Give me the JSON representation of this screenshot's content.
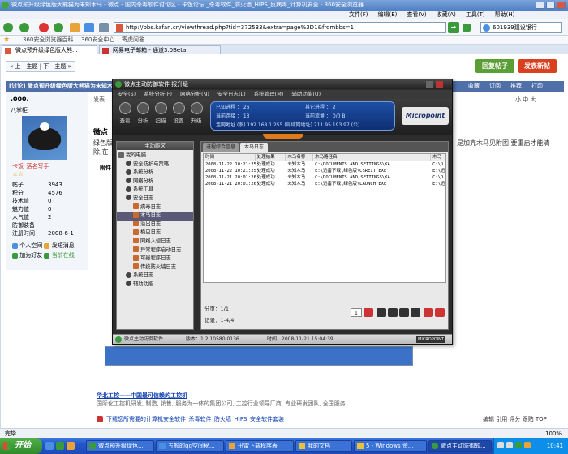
{
  "browser": {
    "window_title": "微点预升级绿色版大熊猫为未知木马 - 微点 - 国内杀毒软件讨论区 - 卡饭论坛 _杀毒软件_防火墙_HIPS_反病毒_计算机安全 - 360安全浏览器",
    "menu": [
      "文件(F)",
      "编辑(E)",
      "查看(V)",
      "收藏(A)",
      "工具(T)",
      "帮助(H)"
    ],
    "address": "http://bbs.kafan.cn/viewthread.php?tid=372533&extra=page%3D1&frombbs=1",
    "go_label": "➜",
    "search_value": "601939建设银行",
    "favorites": [
      "360安全浏览器百科",
      "360安全中心",
      "寄虎问答"
    ],
    "tabs": [
      "微点预升级绿色版大熊...",
      "网易电子邮箱 - 通道3.0Beta"
    ]
  },
  "forum": {
    "nav": "« 上一主题 | 下一主题 »",
    "reply_label": "回复帖子",
    "newpost_label": "发表新帖",
    "thread_bar": "[讨论] 微点预升级绿色版大熊猫为未知木马",
    "thread_tools": [
      "收藏",
      "订阅",
      "推荐",
      "打印"
    ],
    "user": {
      "name": ".ooo.",
      "floor_label": "发表",
      "title": "八掌柜",
      "honor": "卡饭_落名写手",
      "stars": "☆☆",
      "stats": [
        {
          "k": "帖子",
          "v": "3943"
        },
        {
          "k": "积分",
          "v": "4576"
        },
        {
          "k": "技术值",
          "v": "0"
        },
        {
          "k": "魅力值",
          "v": "0"
        },
        {
          "k": "人气值",
          "v": "2"
        },
        {
          "k": "防御装备",
          "v": ""
        },
        {
          "k": "注册时间",
          "v": "2008-6-1"
        }
      ],
      "links": [
        "个人空间",
        "发短消息",
        "加为好友",
        "当前在线"
      ]
    },
    "font_sizes": "小 中 大",
    "post_fragment_left": "微点",
    "post_body_left": "绿色版",
    "post_body_left2": "除,在",
    "post_body_right": "是加壳木马见附图 要重启才能清",
    "attach_label": "附件",
    "ad_title": "华北工控——中国最可信赖的工控机",
    "ad_desc": "国际化工控机研发, 制造, 销售, 服务为一体的集团公司, 工控行业领导厂商, 专业研发团队, 全国服务",
    "bottom_link": "下载您所需要的计算机安全软件_杀毒软件_防火墙_HIPS_安全软件套装",
    "bottom_tools": "编辑 引用 评分 跟贴 TOP"
  },
  "dialog": {
    "title": "微点主动防御软件   报升级",
    "menu": [
      "安全(S)",
      "系统分析(F)",
      "网络分析(N)",
      "安全日志(L)",
      "系统管理(M)",
      "辅助功能(U)"
    ],
    "toolbar": [
      "查看",
      "分析",
      "扫描",
      "设置",
      "升级"
    ],
    "status_panel": {
      "r1": [
        {
          "k": "已知进程",
          "v": "26"
        },
        {
          "k": "其它进程",
          "v": "2"
        }
      ],
      "r2": [
        {
          "k": "当前连接",
          "v": "13"
        },
        {
          "k": "当前流量",
          "v": "0/0 B"
        }
      ],
      "r3": {
        "k": "连网地址",
        "v": "(系)  192.168.1.255 (局域网地址)     211.95.193.97 (公)"
      }
    },
    "logo": "Micropoint",
    "sidebar_header": "主功能区",
    "tree": [
      {
        "label": "我的电脑",
        "lvl": 0,
        "sel": false
      },
      {
        "label": "安全防护与策略",
        "lvl": 1,
        "sel": false
      },
      {
        "label": "系统分析",
        "lvl": 1,
        "sel": false
      },
      {
        "label": "网络分析",
        "lvl": 1,
        "sel": false
      },
      {
        "label": "系统工具",
        "lvl": 1,
        "sel": false
      },
      {
        "label": "安全日志",
        "lvl": 1,
        "sel": false
      },
      {
        "label": "病毒日志",
        "lvl": 2,
        "sel": false
      },
      {
        "label": "木马日志",
        "lvl": 2,
        "sel": true
      },
      {
        "label": "溢出日志",
        "lvl": 2,
        "sel": false
      },
      {
        "label": "桶虫日志",
        "lvl": 2,
        "sel": false
      },
      {
        "label": "网络入侵日志",
        "lvl": 2,
        "sel": false
      },
      {
        "label": "异常程序启动日志",
        "lvl": 2,
        "sel": false
      },
      {
        "label": "可疑程序日志",
        "lvl": 2,
        "sel": false
      },
      {
        "label": "传统防火墙日志",
        "lvl": 2,
        "sel": false
      },
      {
        "label": "系统日志",
        "lvl": 1,
        "sel": false
      },
      {
        "label": "辅助功能",
        "lvl": 1,
        "sel": false
      }
    ],
    "tabs": [
      "进程综合信息",
      "木马日志"
    ],
    "columns": [
      "时间",
      "处理结果",
      "木马名称",
      "木马路径名",
      "木马"
    ],
    "rows": [
      [
        "2008-11-22 10:21:25",
        "处理成功",
        "未知木马",
        "C:\\DOCUMENTS AND SETTINGS\\KA...",
        "C:\\D"
      ],
      [
        "2008-11-22 10:21:25",
        "处理成功",
        "未知木马",
        "E:\\迅雷下载\\绿色版\\CSREIT.EXE",
        "E:\\迅"
      ],
      [
        "2008-11-21 20:01:26",
        "处理成功",
        "未知木马",
        "C:\\DOCUMENTS AND SETTINGS\\KA...",
        "C:\\D"
      ],
      [
        "2008-11-21 20:01:26",
        "处理成功",
        "未知木马",
        "E:\\迅雷下载\\绿色版\\LAUNCH.EXE",
        "E:\\迅"
      ]
    ],
    "page_info": "分页：1/1",
    "record_info": "记录：1-4/4",
    "page_input": "1",
    "footer_left": "微点主动防御软件",
    "footer_ver": "版本：1.2.10580.0136",
    "footer_time": "时间：2008-11-21 15:04:39",
    "footer_right": "MICROPOINT"
  },
  "statusbar": {
    "left": "完毕",
    "zoom": "100%"
  },
  "taskbar": {
    "start": "开始",
    "items": [
      "微点预升级绿色...",
      "五般的qq空间秘...",
      "迅雷下载程序表",
      "我的文档",
      "5 - Windows 资...",
      "微点主动防御软..."
    ],
    "clock": "10:41"
  }
}
